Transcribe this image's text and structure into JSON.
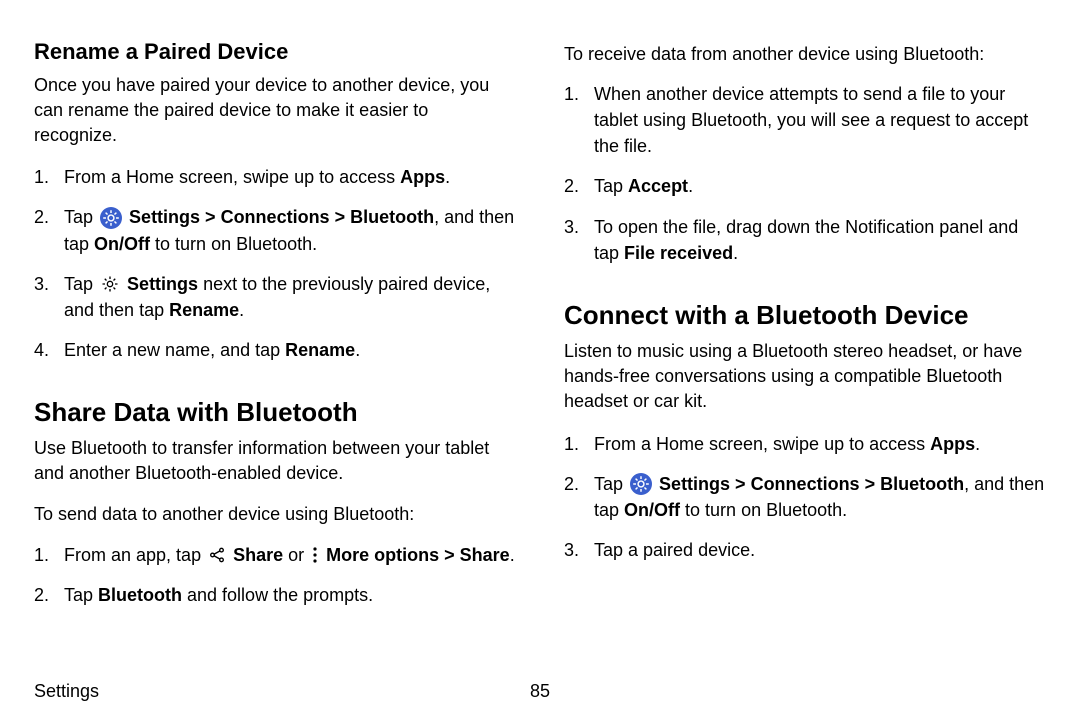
{
  "left": {
    "h2": "Rename a Paired Device",
    "intro": "Once you have paired your device to another device, you can rename the paired device to make it easier to recognize.",
    "rename_steps": {
      "s1_a": "From a Home screen, swipe up to access ",
      "s1_b": "Apps",
      "s1_c": ".",
      "s2_a": "Tap ",
      "s2_b": "Settings > Connections > Bluetooth",
      "s2_c": ", and then tap ",
      "s2_d": "On/Off",
      "s2_e": " to turn on Bluetooth.",
      "s3_a": "Tap ",
      "s3_b": "Settings",
      "s3_c": " next to the previously paired device, and then tap ",
      "s3_d": "Rename",
      "s3_e": ".",
      "s4_a": "Enter a new name, and tap ",
      "s4_b": "Rename",
      "s4_c": "."
    },
    "h1": "Share Data with Bluetooth",
    "share_intro": "Use Bluetooth to transfer information between your tablet and another Bluetooth-enabled device.",
    "send_lead": "To send data to another device using Bluetooth:",
    "send_steps": {
      "s1_a": "From an app, tap ",
      "s1_b": "Share",
      "s1_c": " or ",
      "s1_d": "More options > Share",
      "s1_e": ".",
      "s2_a": "Tap ",
      "s2_b": "Bluetooth",
      "s2_c": " and follow the prompts."
    }
  },
  "right": {
    "recv_lead": "To receive data from another device using Bluetooth:",
    "recv_steps": {
      "s1": "When another device attempts to send a file to your tablet using Bluetooth, you will see a request to accept the file.",
      "s2_a": "Tap ",
      "s2_b": "Accept",
      "s2_c": ".",
      "s3_a": "To open the file, drag down the Notification panel and tap ",
      "s3_b": "File received",
      "s3_c": "."
    },
    "h1": "Connect with a Bluetooth Device",
    "conn_intro": "Listen to music using a Bluetooth stereo headset, or have hands-free conversations using a compatible Bluetooth headset or car kit.",
    "conn_steps": {
      "s1_a": "From a Home screen, swipe up to access ",
      "s1_b": "Apps",
      "s1_c": ".",
      "s2_a": "Tap ",
      "s2_b": "Settings > Connections > Bluetooth",
      "s2_c": ", and then tap ",
      "s2_d": "On/Off",
      "s2_e": " to turn on Bluetooth.",
      "s3": "Tap a paired device."
    }
  },
  "footer": {
    "section": "Settings",
    "page": "85"
  },
  "icons": {
    "settings_blue": "#3A5FCD"
  }
}
